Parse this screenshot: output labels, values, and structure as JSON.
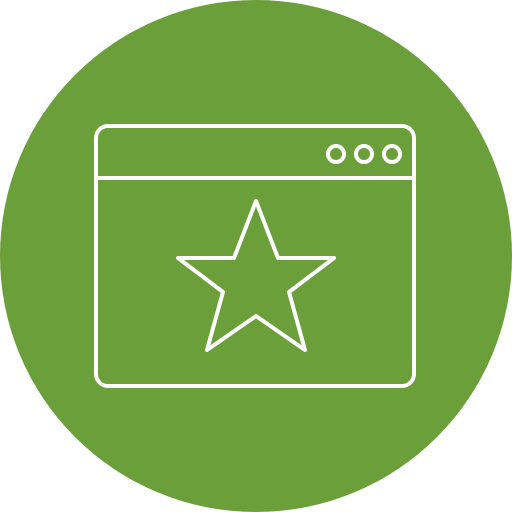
{
  "icon": {
    "name": "favorite-webpage-icon",
    "background_color": "#6a9f3a",
    "stroke_color": "#ffffff",
    "parts": [
      "green-circle-background",
      "browser-window-icon",
      "window-control-dots",
      "star-icon"
    ]
  }
}
